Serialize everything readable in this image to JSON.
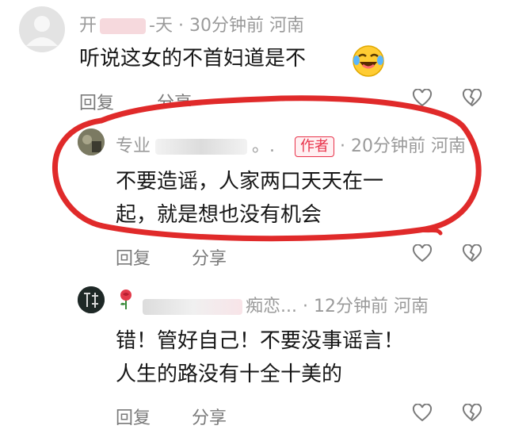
{
  "comments": [
    {
      "username": "开",
      "username_tail": "-天",
      "time": "30分钟前",
      "location": "河南",
      "text": "听说这女的不首妇道是不",
      "emoji": "laughing-crying-emoji",
      "reply_label": "回复",
      "share_label": "分享"
    },
    {
      "username": "专业",
      "username_tail": "。.",
      "badge": "作者",
      "time": "20分钟前",
      "location": "河南",
      "text_line1": "不要造谣，人家两口天天在一",
      "text_line2": "起，就是想也没有机会",
      "reply_label": "回复",
      "share_label": "分享"
    },
    {
      "username_tail": "痴恋...",
      "time": "12分钟前",
      "location": "河南",
      "text_line1": "错！管好自己！不要没事谣言！",
      "text_line2": "人生的路没有十全十美的",
      "reply_label": "回复",
      "share_label": "分享"
    }
  ],
  "colors": {
    "highlight_circle": "#e02a2a",
    "badge": "#e8324a",
    "meta_text": "#9a9a9a"
  }
}
